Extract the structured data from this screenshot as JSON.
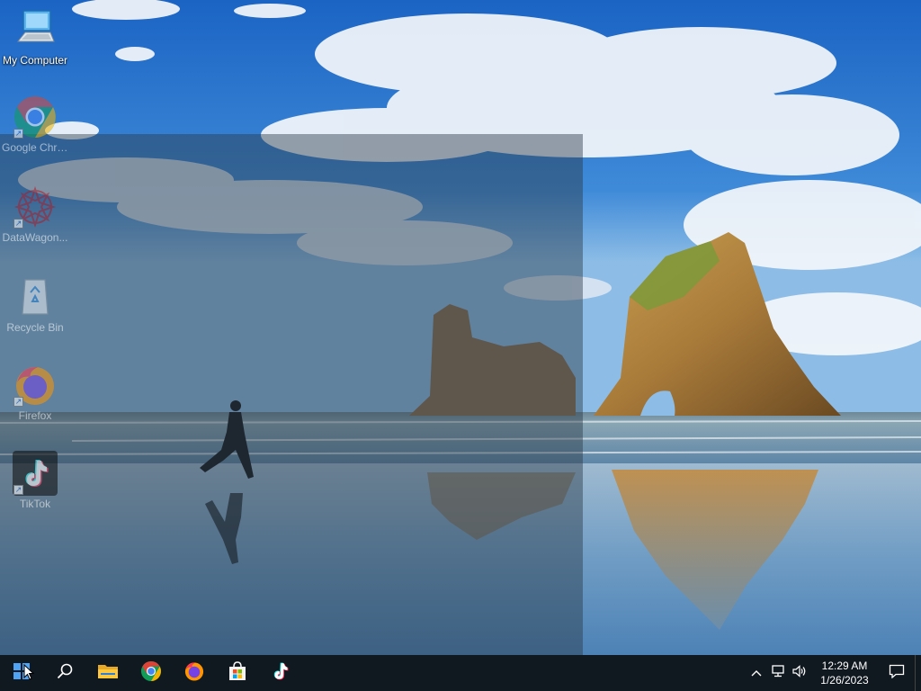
{
  "desktop": {
    "icons": [
      {
        "label": "My Computer",
        "icon": "computer-icon"
      },
      {
        "label": "Google Chrome",
        "icon": "chrome-icon"
      },
      {
        "label": "DataWagon...",
        "icon": "datawagon-icon"
      },
      {
        "label": "Recycle Bin",
        "icon": "recycle-bin-icon"
      },
      {
        "label": "Firefox",
        "icon": "firefox-icon"
      },
      {
        "label": "TikTok",
        "icon": "tiktok-icon"
      }
    ]
  },
  "taskbar": {
    "pinned": [
      {
        "name": "start",
        "icon": "windows-logo-icon"
      },
      {
        "name": "search",
        "icon": "search-icon"
      },
      {
        "name": "file-explorer",
        "icon": "folder-icon"
      },
      {
        "name": "chrome",
        "icon": "chrome-icon"
      },
      {
        "name": "firefox",
        "icon": "firefox-icon"
      },
      {
        "name": "store",
        "icon": "store-icon"
      },
      {
        "name": "tiktok",
        "icon": "tiktok-icon"
      }
    ],
    "tray": {
      "time": "12:29 AM",
      "date": "1/26/2023"
    }
  },
  "colors": {
    "taskbar_bg": "#101820",
    "chrome_red": "#db4437",
    "chrome_green": "#0f9d58",
    "chrome_yellow": "#f4b400",
    "chrome_blue": "#4285f4"
  }
}
